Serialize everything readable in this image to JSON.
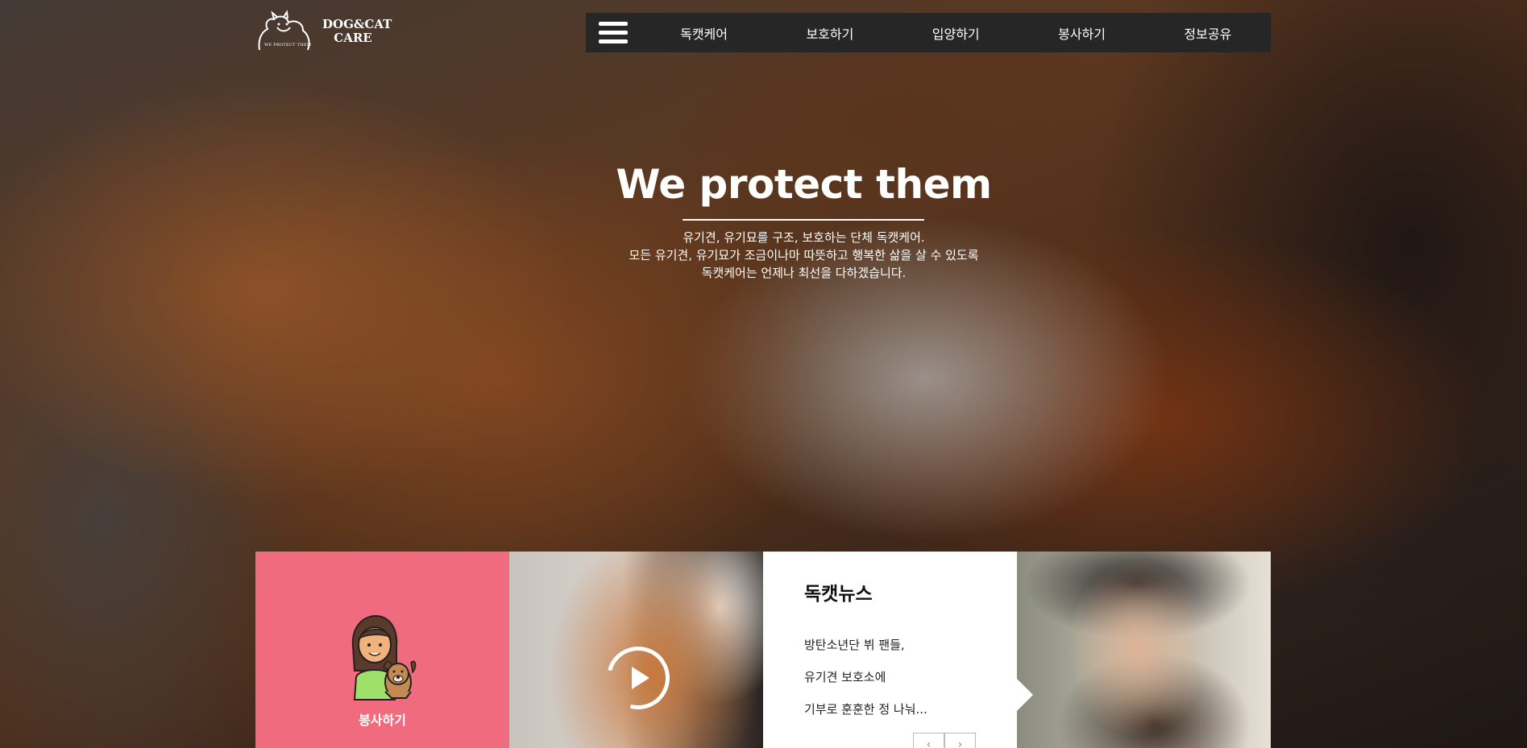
{
  "logo": {
    "line1": "DOG&CAT",
    "line2": "CARE",
    "tagline": "WE PROTECT THEM"
  },
  "nav": {
    "items": [
      {
        "label": "독캣케어"
      },
      {
        "label": "보호하기"
      },
      {
        "label": "입양하기"
      },
      {
        "label": "봉사하기"
      },
      {
        "label": "정보공유"
      }
    ]
  },
  "hero": {
    "title": "We protect them",
    "desc_line1": "유기견, 유기묘를 구조, 보호하는 단체 독캣케어.",
    "desc_line2": "모든 유기견, 유기묘가 조금이나마 따뜻하고 행복한 삶을 살 수 있도록",
    "desc_line3": "독캣케어는 언제나 최선을 다하겠습니다."
  },
  "cards": {
    "volunteer_label": "봉사하기",
    "news": {
      "title": "독캣뉴스",
      "line1": "방탄소년단 뷔 팬들,",
      "line2": "유기견 보호소에",
      "line3": "기부로 훈훈한 정 나눠...",
      "prev": "‹",
      "next": "›"
    }
  },
  "colors": {
    "nav_bg": "#262626",
    "volunteer_bg": "#f06b7d",
    "news_bg": "#ffffff"
  }
}
